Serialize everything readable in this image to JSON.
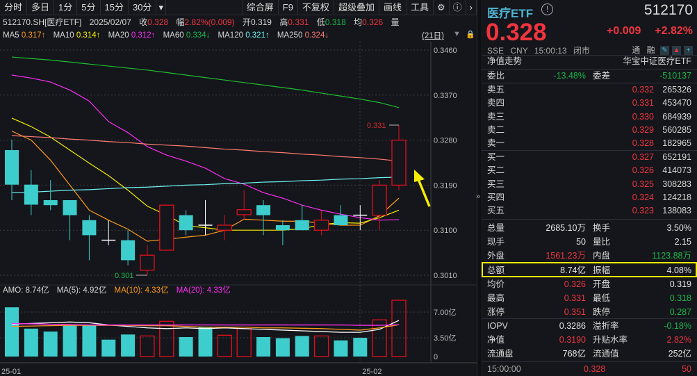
{
  "toolbar": {
    "left": [
      "分时",
      "多日",
      "1分",
      "5分",
      "15分",
      "30分"
    ],
    "more": "▾",
    "right": [
      "综合屏",
      "F9",
      "不复权",
      "超级叠加",
      "画线",
      "工具"
    ]
  },
  "info": {
    "code": "512170.SH[医疗ETF]",
    "date": "2025/02/07",
    "close_label": "收",
    "close": "0.328",
    "chg_label": "幅",
    "chg": "2.82%(0.009)",
    "open_label": "开",
    "open": "0.319",
    "high_label": "高",
    "high": "0.331",
    "low_label": "低",
    "low": "0.318",
    "avg_label": "均",
    "avg": "0.326",
    "vol_label": "量"
  },
  "ma": {
    "ma5": "MA5",
    "ma5v": "0.317↑",
    "ma10": "MA10",
    "ma10v": "0.314↑",
    "ma20": "MA20",
    "ma20v": "0.312↑",
    "ma60": "MA60",
    "ma60v": "0.334↓",
    "ma120": "MA120",
    "ma120v": "0.321↑",
    "ma250": "MA250",
    "ma250v": "0.324↓",
    "period": "(21日)"
  },
  "amo": {
    "label": "AMO:",
    "value": "8.74亿",
    "ma5": "MA(5):",
    "ma5v": "4.92亿",
    "ma10": "MA(10):",
    "ma10v": "4.33亿",
    "ma20": "MA(20):",
    "ma20v": "4.33亿"
  },
  "colors": {
    "up": "#e0101e",
    "down": "#3ecdcd",
    "flat": "#ffffff",
    "ma5": "#ff9a1a",
    "ma10": "#f6ee00",
    "ma20": "#ff2df5",
    "ma60": "#1fbf2f",
    "ma120": "#6ff3f3",
    "ma250": "#ff7a70",
    "highlight": "#f6ee00"
  },
  "chart_data": {
    "type": "candlestick",
    "price_ticks": [
      "0.3460",
      "0.3370",
      "0.3280",
      "0.3190",
      "0.3100",
      "0.3010"
    ],
    "price_range": [
      0.301,
      0.346
    ],
    "high_marker": "0.331",
    "low_marker": "0.301",
    "candles": [
      {
        "o": 0.326,
        "c": 0.3191,
        "h": 0.3281,
        "l": 0.316
      },
      {
        "o": 0.3191,
        "c": 0.3151,
        "h": 0.322,
        "l": 0.313
      },
      {
        "o": 0.316,
        "c": 0.315,
        "h": 0.32,
        "l": 0.314
      },
      {
        "o": 0.316,
        "c": 0.313,
        "h": 0.316,
        "l": 0.308
      },
      {
        "o": 0.312,
        "c": 0.309,
        "h": 0.313,
        "l": 0.304
      },
      {
        "o": 0.308,
        "c": 0.308,
        "h": 0.312,
        "l": 0.307
      },
      {
        "o": 0.308,
        "c": 0.304,
        "h": 0.31,
        "l": 0.303
      },
      {
        "o": 0.302,
        "c": 0.305,
        "h": 0.307,
        "l": 0.301
      },
      {
        "o": 0.306,
        "c": 0.315,
        "h": 0.315,
        "l": 0.306
      },
      {
        "o": 0.313,
        "c": 0.31,
        "h": 0.314,
        "l": 0.309
      },
      {
        "o": 0.311,
        "c": 0.311,
        "h": 0.316,
        "l": 0.309
      },
      {
        "o": 0.31,
        "c": 0.311,
        "h": 0.313,
        "l": 0.308
      },
      {
        "o": 0.3131,
        "c": 0.3141,
        "h": 0.318,
        "l": 0.312
      },
      {
        "o": 0.315,
        "c": 0.313,
        "h": 0.316,
        "l": 0.309
      },
      {
        "o": 0.311,
        "c": 0.31,
        "h": 0.312,
        "l": 0.307
      },
      {
        "o": 0.312,
        "c": 0.31,
        "h": 0.315,
        "l": 0.31
      },
      {
        "o": 0.31,
        "c": 0.312,
        "h": 0.314,
        "l": 0.309
      },
      {
        "o": 0.313,
        "c": 0.311,
        "h": 0.315,
        "l": 0.311
      },
      {
        "o": 0.313,
        "c": 0.313,
        "h": 0.315,
        "l": 0.31
      },
      {
        "o": 0.313,
        "c": 0.319,
        "h": 0.32,
        "l": 0.31
      },
      {
        "o": 0.319,
        "c": 0.328,
        "h": 0.331,
        "l": 0.318
      }
    ],
    "ma_series": {
      "ma5": [
        0.3298,
        0.328,
        0.324,
        0.319,
        0.314,
        0.312,
        0.3102,
        0.3078,
        0.3082,
        0.3086,
        0.309,
        0.31,
        0.3122,
        0.312,
        0.3118,
        0.3118,
        0.3114,
        0.311,
        0.311,
        0.3129,
        0.3164
      ],
      "ma10": [
        0.3324,
        0.3307,
        0.3286,
        0.326,
        0.3234,
        0.3209,
        0.318,
        0.3148,
        0.313,
        0.3109,
        0.3105,
        0.31,
        0.31,
        0.31,
        0.31,
        0.3103,
        0.3111,
        0.3115,
        0.3114,
        0.3125,
        0.314
      ],
      "ma20": [
        0.341,
        0.3404,
        0.3396,
        0.338,
        0.3358,
        0.3317,
        0.3295,
        0.3267,
        0.325,
        0.3238,
        0.3224,
        0.3203,
        0.3192,
        0.3175,
        0.3164,
        0.315,
        0.314,
        0.3132,
        0.3125,
        0.312,
        0.3121
      ],
      "ma60": [
        0.3446,
        0.3443,
        0.344,
        0.3436,
        0.3432,
        0.3428,
        0.3424,
        0.342,
        0.3415,
        0.341,
        0.3405,
        0.34,
        0.3395,
        0.339,
        0.3385,
        0.338,
        0.3374,
        0.3368,
        0.3362,
        0.3355,
        0.3345
      ],
      "ma120": [
        0.3175,
        0.3176,
        0.3178,
        0.318,
        0.3181,
        0.3183,
        0.3185,
        0.3186,
        0.3188,
        0.319,
        0.3191,
        0.3193,
        0.3194,
        0.3196,
        0.3197,
        0.3199,
        0.32,
        0.3202,
        0.3203,
        0.3205,
        0.3206
      ],
      "ma250": [
        0.3289,
        0.3287,
        0.3285,
        0.3282,
        0.328,
        0.3277,
        0.3275,
        0.3272,
        0.327,
        0.3268,
        0.3265,
        0.3262,
        0.326,
        0.3257,
        0.3255,
        0.3252,
        0.325,
        0.3247,
        0.3245,
        0.3242,
        0.3238
      ]
    },
    "volume_ticks": [
      "7.00亿",
      "3.50亿",
      "0"
    ],
    "volume_range": [
      0,
      8.3
    ],
    "volumes": [
      6.7,
      3.8,
      3.4,
      4.3,
      4.3,
      2.3,
      3.0,
      2.8,
      4.8,
      2.65,
      4.0,
      2.9,
      3.8,
      2.65,
      2.5,
      2.8,
      2.8,
      2.2,
      2.55,
      5.0,
      8.74
    ],
    "volume_ma": {
      "ma5": [
        4.4,
        4.5,
        4.6,
        4.7,
        4.6,
        4.3,
        4.1,
        3.9,
        3.8,
        3.9,
        3.8,
        3.9,
        3.8,
        3.7,
        3.6,
        3.5,
        3.4,
        3.3,
        3.3,
        3.7,
        4.92
      ],
      "ma10": [
        4.1,
        4.15,
        4.2,
        4.25,
        4.25,
        4.25,
        4.25,
        4.2,
        4.2,
        4.1,
        4.0,
        4.0,
        4.0,
        3.9,
        3.9,
        3.85,
        3.8,
        3.7,
        3.6,
        3.9,
        4.33
      ],
      "ma20": [
        4.5,
        4.45,
        4.4,
        4.35,
        4.3,
        4.3,
        4.3,
        4.3,
        4.3,
        4.3,
        4.3,
        4.3,
        4.3,
        4.3,
        4.3,
        4.3,
        4.3,
        4.3,
        4.25,
        4.25,
        4.33
      ]
    },
    "date_labels": [
      {
        "index": 0,
        "label": "25-01"
      },
      {
        "index": 18,
        "label": "25-02"
      }
    ]
  },
  "right": {
    "name": "医疗ETF",
    "code": "512170",
    "price": "0.328",
    "change": "+0.009",
    "change_pct": "+2.82%",
    "sub": [
      "SSE",
      "CNY",
      "15:00:13",
      "闭市"
    ],
    "tags": [
      "通",
      "融"
    ],
    "nav_trend": "净值走势",
    "fund_name": "华宝中证医疗ETF",
    "weibi_label": "委比",
    "weibi": "-13.48%",
    "weicha_label": "委差",
    "weicha": "-510137",
    "asks": [
      {
        "l": "卖五",
        "p": "0.332",
        "v": "265326"
      },
      {
        "l": "卖四",
        "p": "0.331",
        "v": "453470"
      },
      {
        "l": "卖三",
        "p": "0.330",
        "v": "684939"
      },
      {
        "l": "卖二",
        "p": "0.329",
        "v": "560285"
      },
      {
        "l": "卖一",
        "p": "0.328",
        "v": "182965"
      }
    ],
    "bids": [
      {
        "l": "买一",
        "p": "0.327",
        "v": "652191"
      },
      {
        "l": "买二",
        "p": "0.326",
        "v": "414073"
      },
      {
        "l": "买三",
        "p": "0.325",
        "v": "308283"
      },
      {
        "l": "买四",
        "p": "0.324",
        "v": "124218"
      },
      {
        "l": "买五",
        "p": "0.323",
        "v": "138083"
      }
    ],
    "stats": [
      {
        "l1": "总量",
        "v1": "2685.10万",
        "c1": "white",
        "l2": "换手",
        "v2": "3.50%",
        "c2": "white"
      },
      {
        "l1": "现手",
        "v1": "50",
        "c1": "white",
        "l2": "量比",
        "v2": "2.15",
        "c2": "white"
      },
      {
        "l1": "外盘",
        "v1": "1561.23万",
        "c1": "red",
        "l2": "内盘",
        "v2": "1123.88万",
        "c2": "green"
      },
      {
        "l1": "总额",
        "v1": "8.74亿",
        "c1": "white",
        "l2": "振幅",
        "v2": "4.08%",
        "c2": "white"
      },
      {
        "l1": "均价",
        "v1": "0.326",
        "c1": "red",
        "l2": "开盘",
        "v2": "0.319",
        "c2": "white"
      },
      {
        "l1": "最高",
        "v1": "0.331",
        "c1": "red",
        "l2": "最低",
        "v2": "0.318",
        "c2": "green"
      },
      {
        "l1": "涨停",
        "v1": "0.351",
        "c1": "red",
        "l2": "跌停",
        "v2": "0.287",
        "c2": "green"
      }
    ],
    "stats2": [
      {
        "l1": "IOPV",
        "v1": "0.3286",
        "c1": "white",
        "l2": "溢折率",
        "v2": "-0.18%",
        "c2": "green"
      },
      {
        "l1": "净值",
        "v1": "0.3190",
        "c1": "red",
        "l2": "升贴水率",
        "v2": "2.82%",
        "c2": "red"
      },
      {
        "l1": "流通盘",
        "v1": "768亿",
        "c1": "white",
        "l2": "流通值",
        "v2": "252亿",
        "c2": "white"
      }
    ],
    "tick": {
      "time": "15:00:00",
      "price": "0.328",
      "vol": "50"
    }
  }
}
